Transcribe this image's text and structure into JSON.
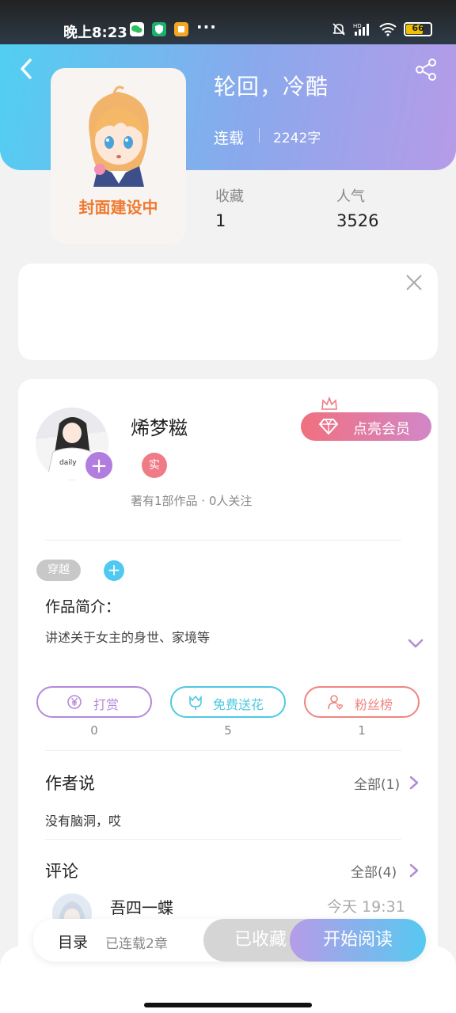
{
  "status_bar": {
    "time": "晚上8:23",
    "more": "···",
    "battery": "66",
    "battery_level_percent": 66
  },
  "book": {
    "cover_text": "封面建设中",
    "title": "轮回，冷酷",
    "status": "连载",
    "word_count": "2242字"
  },
  "stats": {
    "favorites_label": "收藏",
    "favorites_value": "1",
    "popularity_label": "人气",
    "popularity_value": "3526"
  },
  "author": {
    "name": "烯梦糍",
    "verified_badge": "实",
    "meta": "著有1部作品 · 0人关注",
    "vip_button": "点亮会员"
  },
  "tags": [
    "穿越"
  ],
  "intro": {
    "heading": "作品简介：",
    "text": "讲述关于女主的身世、家境等"
  },
  "actions": [
    {
      "label": "打赏",
      "count": "0",
      "color": "#b48ad8"
    },
    {
      "label": "免费送花",
      "count": "5",
      "color": "#4fc9e0"
    },
    {
      "label": "粉丝榜",
      "count": "1",
      "color": "#ef8580"
    }
  ],
  "author_say": {
    "title": "作者说",
    "more": "全部(1)",
    "text": "没有脑洞，哎"
  },
  "comments": {
    "title": "评论",
    "more": "全部(4)",
    "first_user": "吾四一蝶",
    "first_time": "今天 19:31"
  },
  "bottom_bar": {
    "toc": "目录",
    "chapters": "已连载2章",
    "collected": "已收藏",
    "read": "开始阅读"
  }
}
